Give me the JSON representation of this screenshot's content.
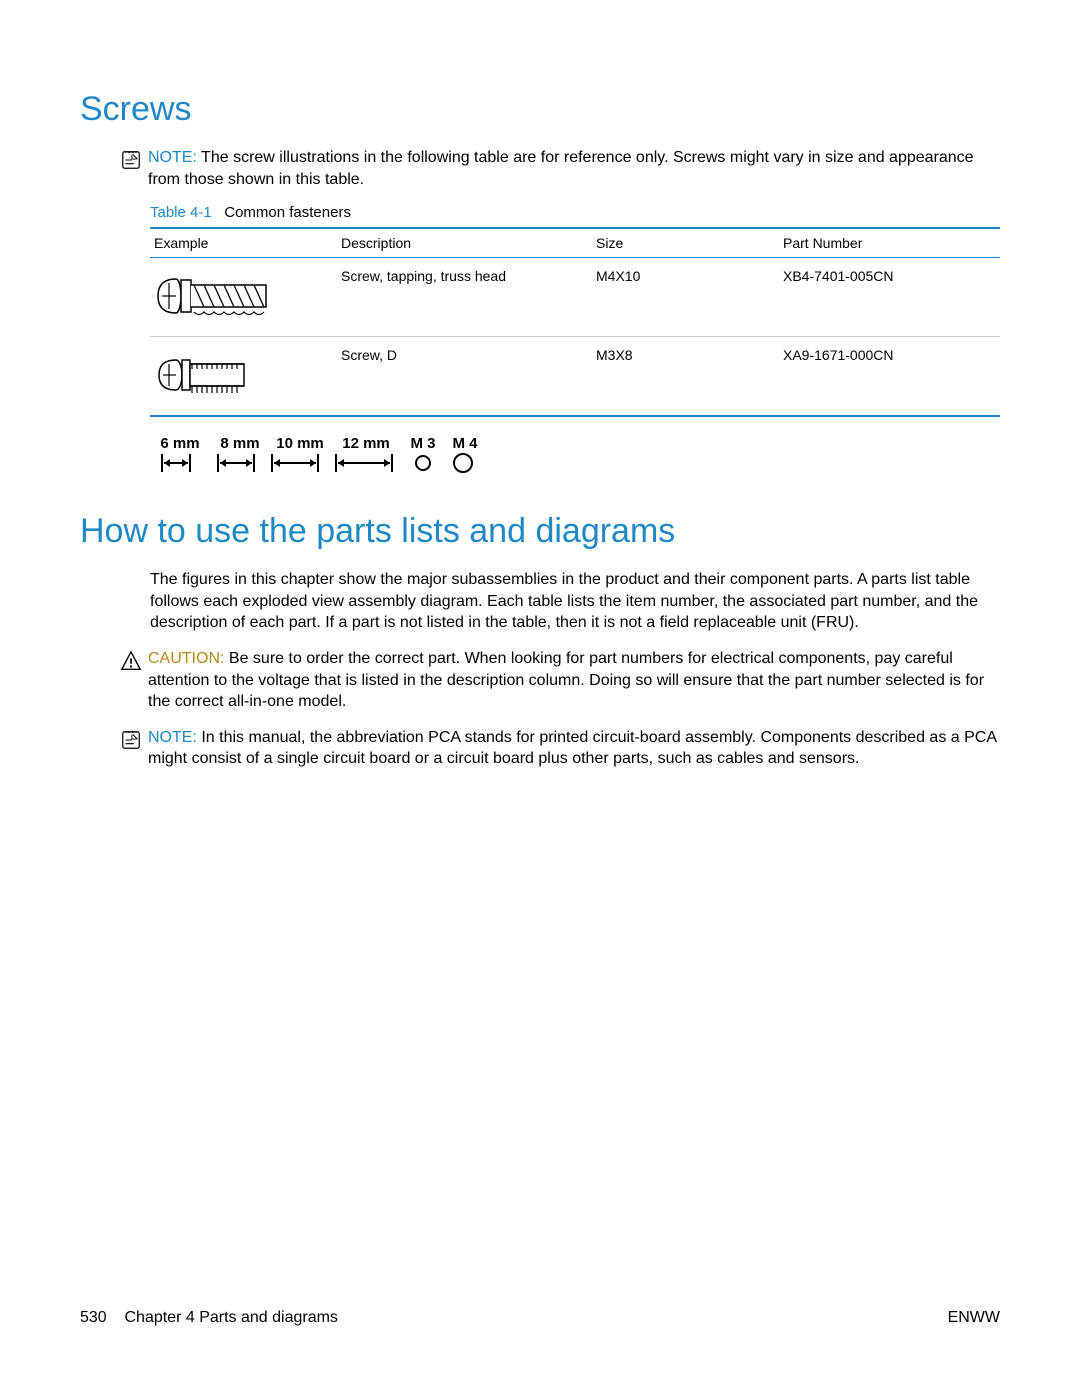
{
  "heading1": "Screws",
  "note1": {
    "label": "NOTE:",
    "text": "The screw illustrations in the following table are for reference only. Screws might vary in size and appearance from those shown in this table."
  },
  "table": {
    "number": "Table 4-1",
    "title": "Common fasteners",
    "headers": {
      "c0": "Example",
      "c1": "Description",
      "c2": "Size",
      "c3": "Part Number"
    },
    "rows": [
      {
        "desc": "Screw, tapping, truss head",
        "size": "M4X10",
        "part": "XB4-7401-005CN"
      },
      {
        "desc": "Screw, D",
        "size": "M3X8",
        "part": "XA9-1671-000CN"
      }
    ]
  },
  "ruler": {
    "l6": "6 mm",
    "l8": "8 mm",
    "l10": "10 mm",
    "l12": "12 mm",
    "m3": "M 3",
    "m4": "M 4"
  },
  "heading2": "How to use the parts lists and diagrams",
  "para": "The figures in this chapter show the major subassemblies in the product and their component parts. A parts list table follows each exploded view assembly diagram. Each table lists the item number, the associated part number, and the description of each part. If a part is not listed in the table, then it is not a field replaceable unit (FRU).",
  "caution": {
    "label": "CAUTION:",
    "text": "Be sure to order the correct part. When looking for part numbers for electrical components, pay careful attention to the voltage that is listed in the description column. Doing so will ensure that the part number selected is for the correct all-in-one model."
  },
  "note2": {
    "label": "NOTE:",
    "text": "In this manual, the abbreviation  PCA  stands for  printed circuit-board assembly. Components described as a PCA might consist of a single circuit board or a circuit board plus other parts, such as cables and sensors."
  },
  "footer": {
    "page": "530",
    "chapter": "Chapter 4   Parts and diagrams",
    "right": "ENWW"
  }
}
